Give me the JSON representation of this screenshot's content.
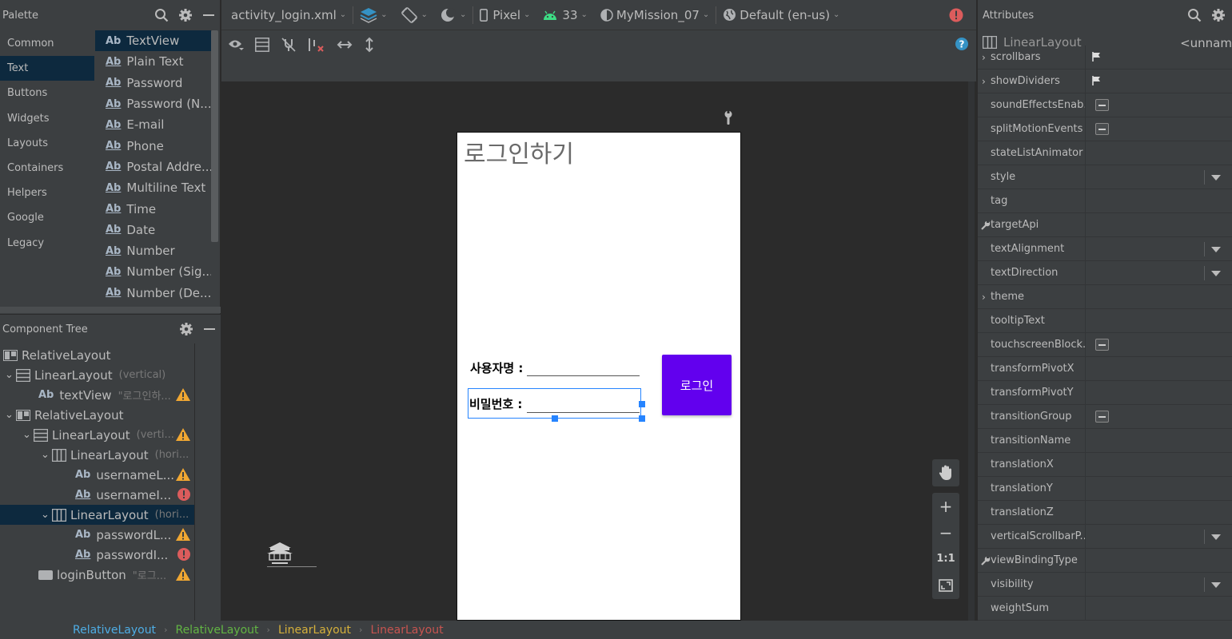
{
  "palette": {
    "title": "Palette",
    "categories": [
      "Common",
      "Text",
      "Buttons",
      "Widgets",
      "Layouts",
      "Containers",
      "Helpers",
      "Google",
      "Legacy"
    ],
    "selected_category": "Text",
    "widgets": [
      "TextView",
      "Plain Text",
      "Password",
      "Password (N...",
      "E-mail",
      "Phone",
      "Postal Addre...",
      "Multiline Text",
      "Time",
      "Date",
      "Number",
      "Number (Sig...",
      "Number (De..."
    ],
    "ab_glyph": "Ab"
  },
  "component_tree": {
    "title": "Component Tree",
    "rows": [
      {
        "label": "RelativeLayout",
        "hint": ""
      },
      {
        "label": "LinearLayout",
        "hint": "(vertical)"
      },
      {
        "label": "textView",
        "hint": "\"로그인하..."
      },
      {
        "label": "RelativeLayout",
        "hint": ""
      },
      {
        "label": "LinearLayout",
        "hint": "(verti..."
      },
      {
        "label": "LinearLayout",
        "hint": "(hori..."
      },
      {
        "label": "usernameL...",
        "hint": ""
      },
      {
        "label": "usernameI...",
        "hint": ""
      },
      {
        "label": "LinearLayout",
        "hint": "(hori..."
      },
      {
        "label": "passwordL...",
        "hint": ""
      },
      {
        "label": "passwordI...",
        "hint": ""
      },
      {
        "label": "loginButton",
        "hint": "\"로그..."
      }
    ]
  },
  "toolbar": {
    "file": "activity_login.xml",
    "device": "Pixel",
    "api": "33",
    "theme": "MyMission_07",
    "locale": "Default (en-us)"
  },
  "device_preview": {
    "title_text": "로그인하기",
    "username_label": "사용자명 :",
    "password_label": "비밀번호 :",
    "login_button": "로그인",
    "button_color": "#6200ee"
  },
  "zoom": {
    "plus": "+",
    "minus": "−",
    "one_to_one": "1:1"
  },
  "attributes": {
    "title": "Attributes",
    "component": "LinearLayout",
    "component_id": "<unnam",
    "rows": [
      {
        "name": "scrollbars",
        "kind": "flag",
        "expand": true
      },
      {
        "name": "showDividers",
        "kind": "flag",
        "expand": true
      },
      {
        "name": "soundEffectsEnab...",
        "kind": "minus"
      },
      {
        "name": "splitMotionEvents",
        "kind": "minus"
      },
      {
        "name": "stateListAnimator",
        "kind": "text"
      },
      {
        "name": "style",
        "kind": "dropdown"
      },
      {
        "name": "tag",
        "kind": "text"
      },
      {
        "name": "targetApi",
        "kind": "wrench"
      },
      {
        "name": "textAlignment",
        "kind": "dropdown"
      },
      {
        "name": "textDirection",
        "kind": "dropdown"
      },
      {
        "name": "theme",
        "kind": "text",
        "expand": true
      },
      {
        "name": "tooltipText",
        "kind": "text"
      },
      {
        "name": "touchscreenBlock...",
        "kind": "minus"
      },
      {
        "name": "transformPivotX",
        "kind": "text"
      },
      {
        "name": "transformPivotY",
        "kind": "text"
      },
      {
        "name": "transitionGroup",
        "kind": "minus"
      },
      {
        "name": "transitionName",
        "kind": "text"
      },
      {
        "name": "translationX",
        "kind": "text"
      },
      {
        "name": "translationY",
        "kind": "text"
      },
      {
        "name": "translationZ",
        "kind": "text"
      },
      {
        "name": "verticalScrollbarP...",
        "kind": "dropdown"
      },
      {
        "name": "viewBindingType",
        "kind": "wrench"
      },
      {
        "name": "visibility",
        "kind": "dropdown"
      },
      {
        "name": "weightSum",
        "kind": "text"
      }
    ]
  },
  "breadcrumb": [
    {
      "label": "RelativeLayout",
      "color": "#4eade5"
    },
    {
      "label": "RelativeLayout",
      "color": "#62b543"
    },
    {
      "label": "LinearLayout",
      "color": "#d5b03b"
    },
    {
      "label": "LinearLayout",
      "color": "#c75450"
    }
  ]
}
